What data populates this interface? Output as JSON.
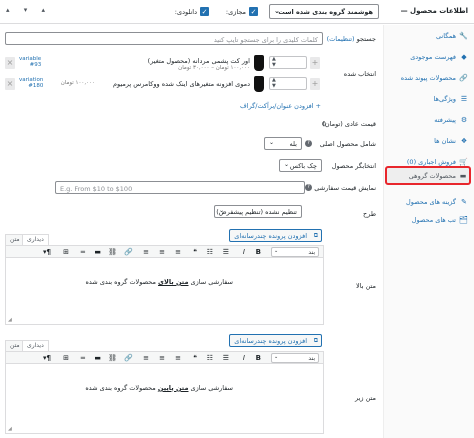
{
  "header": {
    "title": "اطلاعات محصول —",
    "product_type": "هوشمند گروه بندی شده است",
    "virtual_label": "مجازی:",
    "download_label": "دانلودی:",
    "check": "✓",
    "window_controls": "▴ ▾ ▴"
  },
  "sidebar": {
    "items": [
      {
        "label": "همگانی",
        "icon": "wrench-icon",
        "glyph": "🔧"
      },
      {
        "label": "فهرست موجودی",
        "icon": "inventory-icon",
        "glyph": "◆"
      },
      {
        "label": "محصولات پیوند شده",
        "icon": "link-icon",
        "glyph": "🔗"
      },
      {
        "label": "ویژگی‌ها",
        "icon": "list-icon",
        "glyph": "☰"
      },
      {
        "label": "پیشرفته",
        "icon": "gear-icon",
        "glyph": "⚙"
      },
      {
        "label": "نشان ها",
        "icon": "badge-icon",
        "glyph": "❖"
      },
      {
        "label": "فروش اجباری (0)",
        "icon": "cart-icon",
        "glyph": "🛒"
      },
      {
        "label": "محصولات گروهی",
        "icon": "group-icon",
        "glyph": "▬"
      },
      {
        "label": "گزینه های محصول",
        "icon": "options-icon",
        "glyph": "✎"
      },
      {
        "label": "تب های محصول",
        "icon": "tabs-icon",
        "glyph": "🗂"
      }
    ]
  },
  "search": {
    "label": "جستجو (تنظیمات)",
    "label_main": "جستجو",
    "label_link": "(تنظیمات)",
    "placeholder": "کلمات کلیدی را برای جستجو تایپ کنید"
  },
  "products": {
    "label": "انتخاب شده",
    "rows": [
      {
        "name": "اور کت پشمی مردانه (محصول متغیر)",
        "price": "۱۰۰,۰۰۰ تومان – ۳۰,۰۰۰ تومان",
        "tag": "variable",
        "id": "#93"
      },
      {
        "name": "دموی افزونه متغیرهای اینک شده ووکامرس پرمیوم",
        "price": "۱۰۰,۰۰۰ تومان",
        "tag": "variation",
        "id": "#180"
      }
    ],
    "add_title_link": "+ افزودن عنوان/برآکت/گراف"
  },
  "regular_price": {
    "label": "قیمت عادی (تومان)",
    "value": "0"
  },
  "include_parent": {
    "label": "شامل محصول اصلی",
    "value": "بله"
  },
  "product_picker": {
    "label": "انتخابگر محصول",
    "value": "چک باکس"
  },
  "price_display": {
    "label": "نمایش قیمت سفارشی",
    "placeholder": "E.g. From $10 to $100"
  },
  "layout": {
    "label": "طرح",
    "value": "تنظیم نشده (تنظیم پیشفرض)"
  },
  "editor_top": {
    "label": "متن بالا",
    "media_button": "افزودن پرونده چندرسانه‌ای",
    "tab_visual": "دیداری",
    "tab_text": "متن",
    "format": "بند",
    "content_pre": "سفارشی سازی ",
    "content_bold": "متن بالای",
    "content_post": " محصولات گروه بندی شده"
  },
  "editor_bottom": {
    "label": "متن زیر",
    "media_button": "افزودن پرونده چندرسانه‌ای",
    "tab_visual": "دیداری",
    "tab_text": "متن",
    "format": "بند",
    "content_pre": "سفارشی سازی ",
    "content_bold": "متن پایین",
    "content_post": " محصولات گروه بندی شده"
  },
  "toolbar_glyphs": [
    "B",
    "I",
    "≡",
    "❝",
    "≡",
    "≡",
    "≡",
    "🔗",
    "⛓",
    "≡",
    "⊞",
    "¶"
  ]
}
